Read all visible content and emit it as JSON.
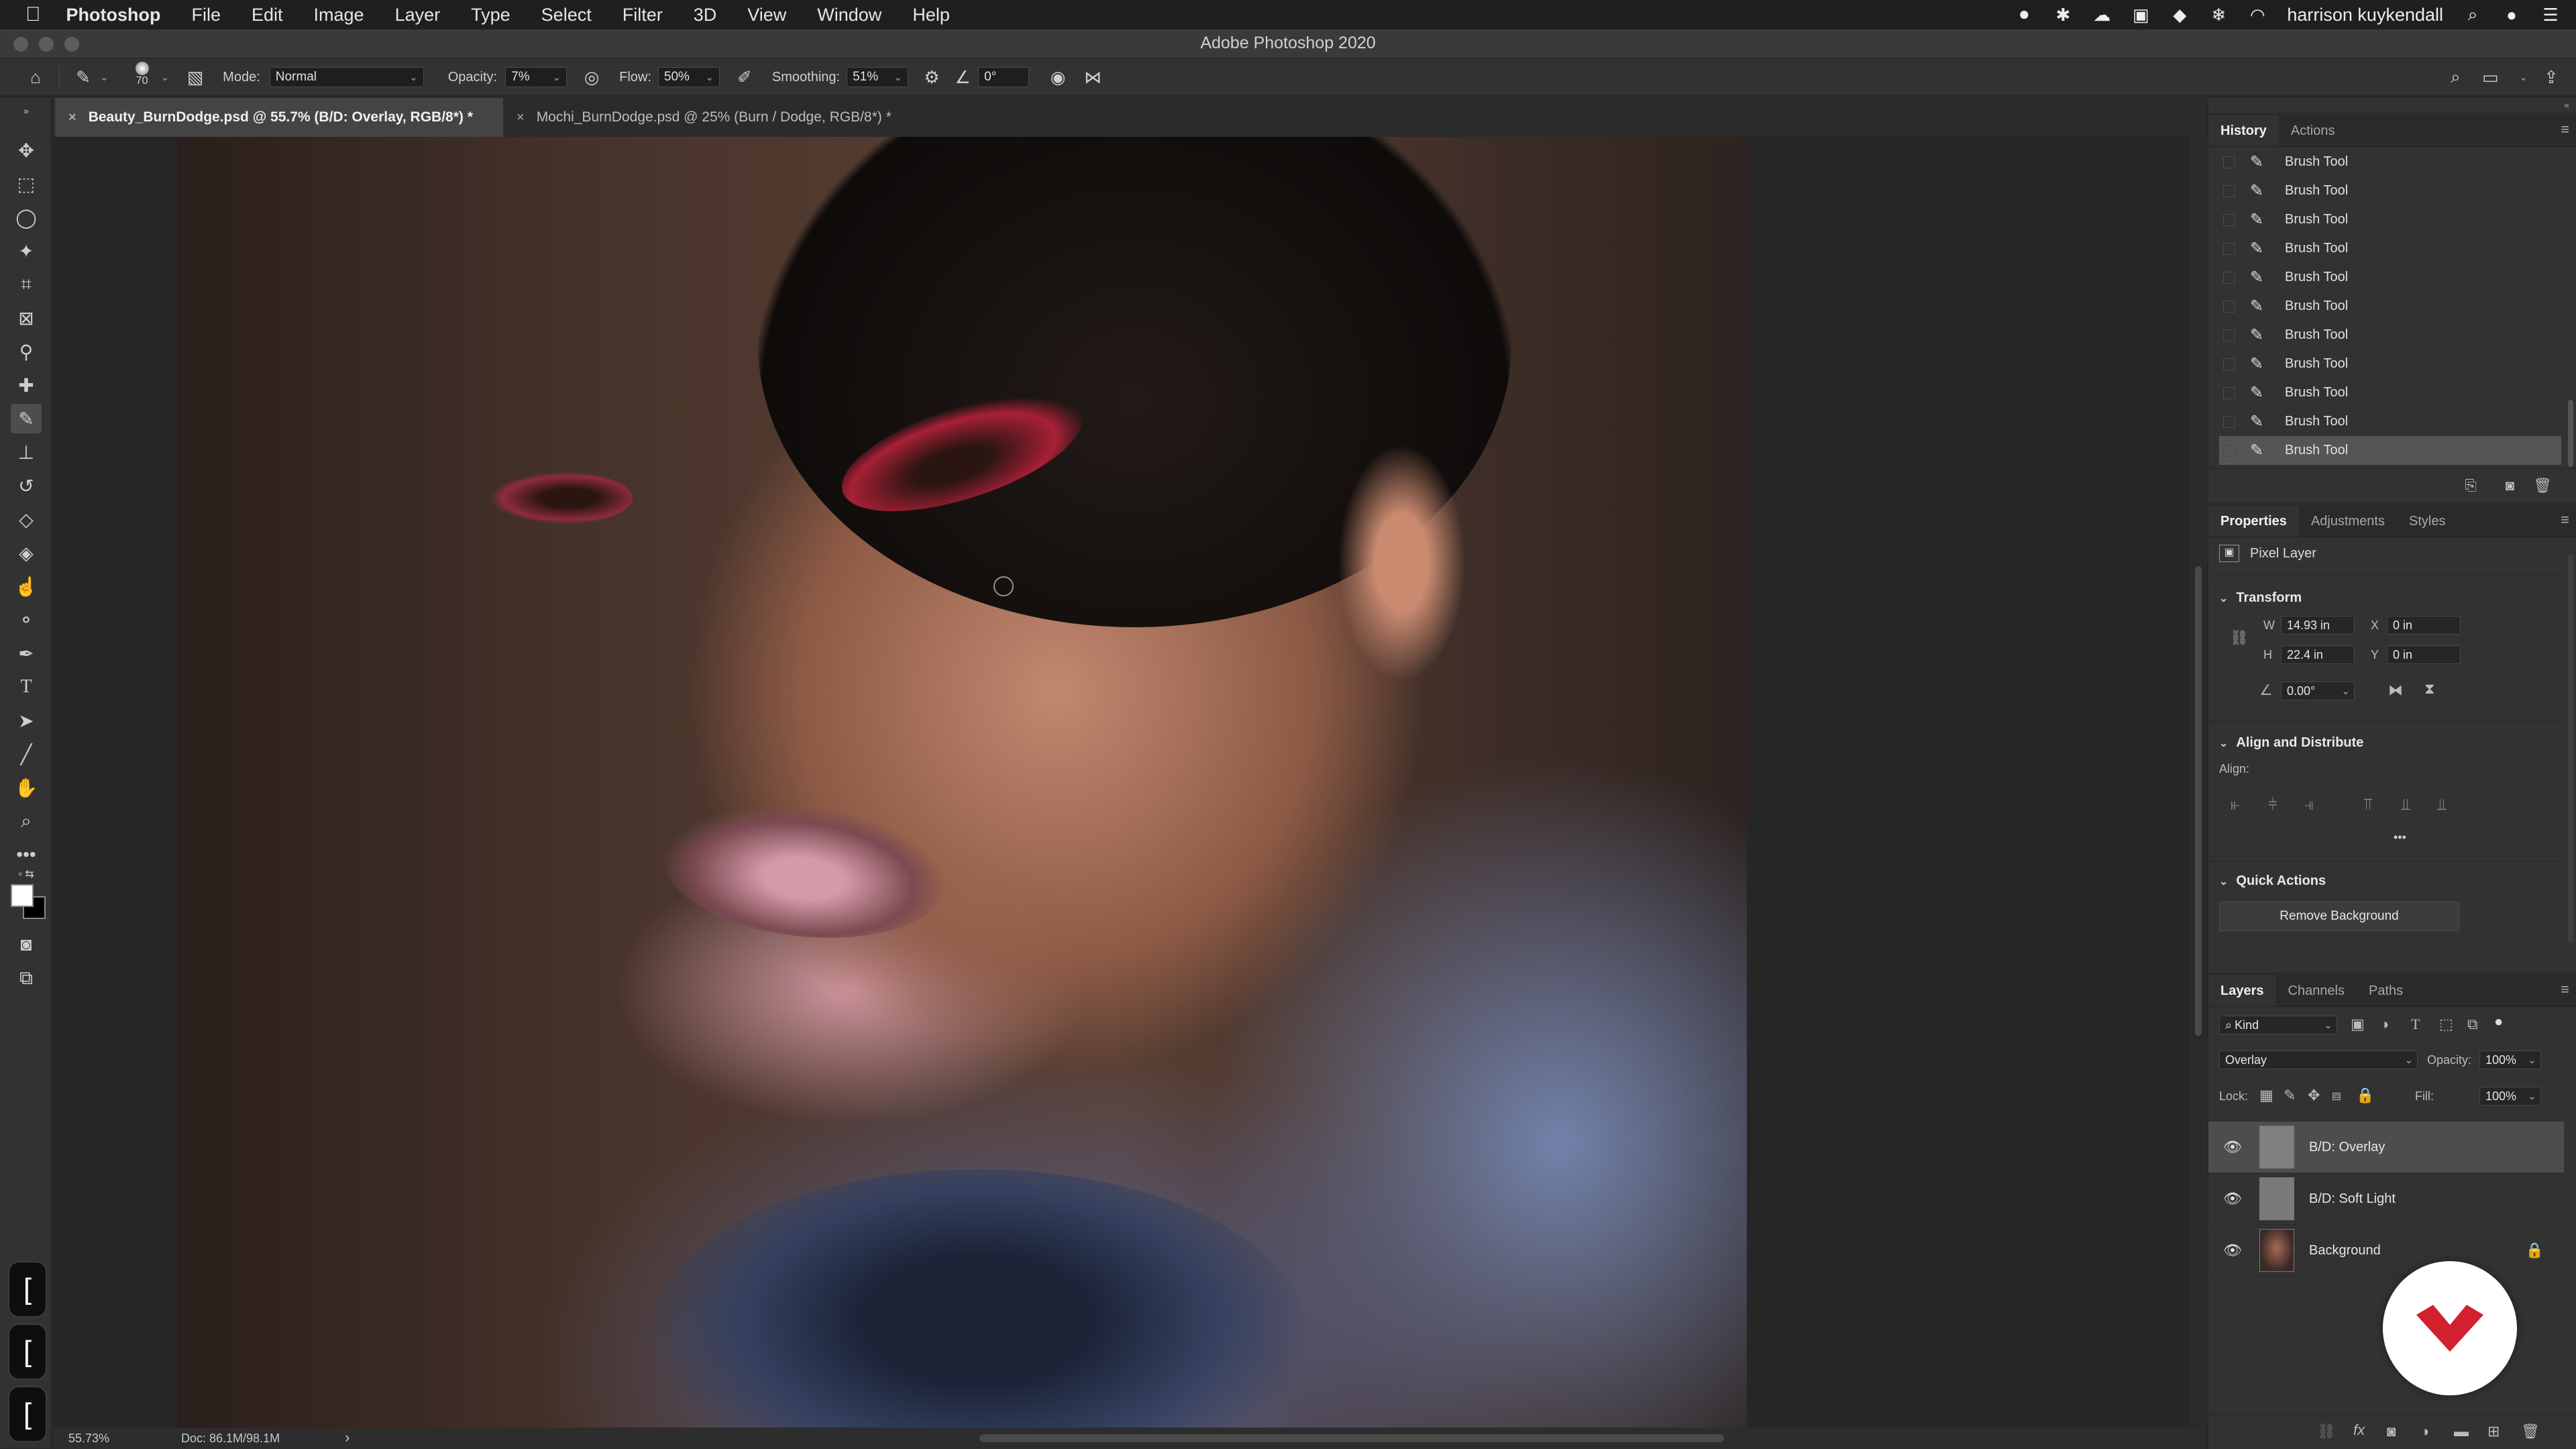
{
  "menubar": {
    "app": "Photoshop",
    "items": [
      "File",
      "Edit",
      "Image",
      "Layer",
      "Type",
      "Select",
      "Filter",
      "3D",
      "View",
      "Window",
      "Help"
    ],
    "user": "harrison kuykendall"
  },
  "window": {
    "title": "Adobe Photoshop 2020"
  },
  "options": {
    "brush_size": "70",
    "mode_label": "Mode:",
    "mode_value": "Normal",
    "opacity_label": "Opacity:",
    "opacity_value": "7%",
    "flow_label": "Flow:",
    "flow_value": "50%",
    "smoothing_label": "Smoothing:",
    "smoothing_value": "51%",
    "angle_value": "0°"
  },
  "tabs": [
    {
      "label": "Beauty_BurnDodge.psd @ 55.7% (B/D: Overlay, RGB/8*) *",
      "active": true
    },
    {
      "label": "Mochi_BurnDodge.psd @ 25% (Burn / Dodge, RGB/8*) *",
      "active": false
    }
  ],
  "status": {
    "zoom": "55.73%",
    "doc": "Doc: 86.1M/98.1M",
    "arrow": "›"
  },
  "history": {
    "tabs": [
      "History",
      "Actions"
    ],
    "items": [
      "Brush Tool",
      "Brush Tool",
      "Brush Tool",
      "Brush Tool",
      "Brush Tool",
      "Brush Tool",
      "Brush Tool",
      "Brush Tool",
      "Brush Tool",
      "Brush Tool",
      "Brush Tool"
    ]
  },
  "properties": {
    "tabs": [
      "Properties",
      "Adjustments",
      "Styles"
    ],
    "layer_type": "Pixel Layer",
    "transform_title": "Transform",
    "w_label": "W",
    "w_value": "14.93 in",
    "h_label": "H",
    "h_value": "22.4 in",
    "x_label": "X",
    "x_value": "0 in",
    "y_label": "Y",
    "y_value": "0 in",
    "angle_value": "0.00°",
    "align_title": "Align and Distribute",
    "align_label": "Align:",
    "more": "•••",
    "quick_title": "Quick Actions",
    "remove_bg": "Remove Background"
  },
  "layers": {
    "tabs": [
      "Layers",
      "Channels",
      "Paths"
    ],
    "kind": "Kind",
    "blend_mode": "Overlay",
    "opacity_label": "Opacity:",
    "opacity_value": "100%",
    "lock_label": "Lock:",
    "fill_label": "Fill:",
    "fill_value": "100%",
    "items": [
      {
        "name": "B/D: Overlay",
        "selected": true
      },
      {
        "name": "B/D: Soft Light",
        "selected": false
      },
      {
        "name": "Background",
        "selected": false,
        "locked": true
      }
    ]
  },
  "overlay": {
    "bracket": "["
  },
  "colors": {
    "accent_red": "#d2202f",
    "selection": "#4d4d4d"
  }
}
